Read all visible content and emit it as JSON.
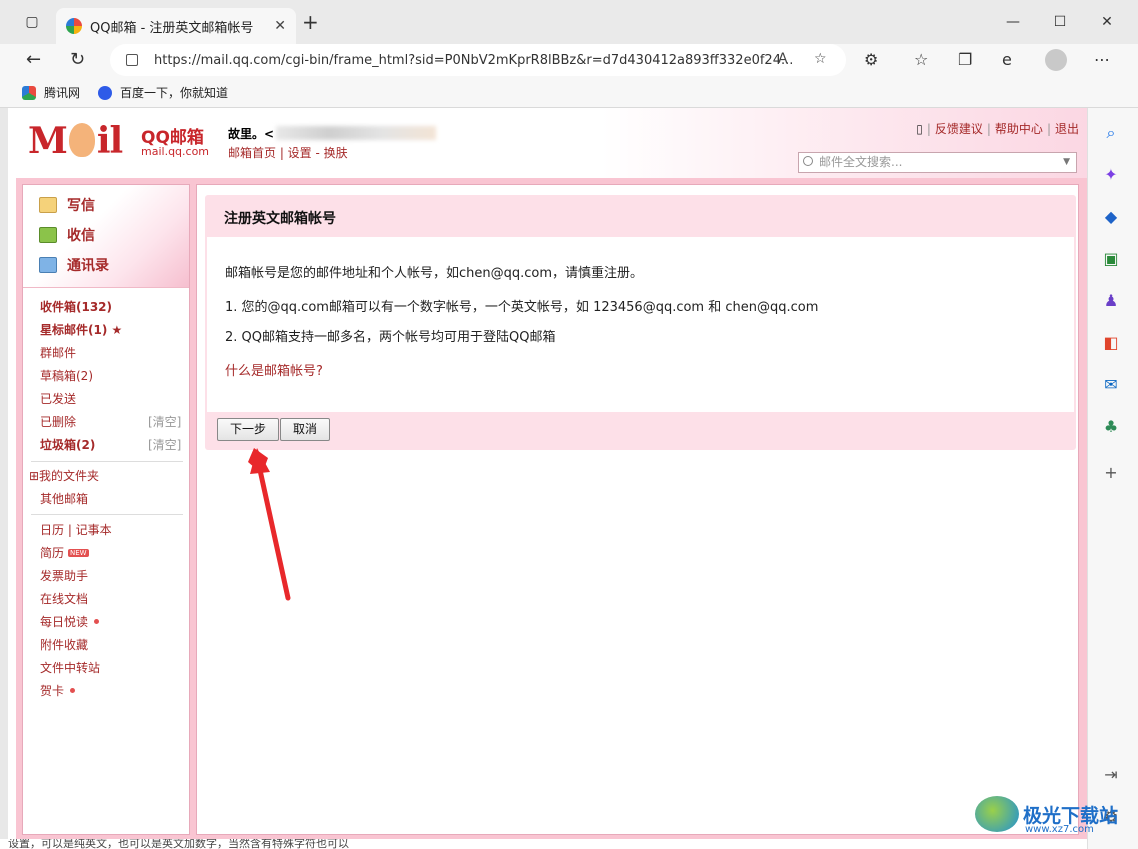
{
  "browser": {
    "tab_title": "QQ邮箱 - 注册英文邮箱帐号",
    "url": "https://mail.qq.com/cgi-bin/frame_html?sid=P0NbV2mKprR8lBBz&r=d7d430412a893ff332e0f24...",
    "bookmarks": [
      "腾讯网",
      "百度一下，你就知道"
    ]
  },
  "header": {
    "logo_text": "M il",
    "brand": "QQ邮箱",
    "domain": "mail.qq.com",
    "user_prefix": "故里。<",
    "user_links": "邮箱首页 | 设置 - 换肤",
    "top_links": [
      "反馈建议",
      "帮助中心",
      "退出"
    ],
    "search_placeholder": "邮件全文搜索..."
  },
  "sidebar": {
    "actions": [
      "写信",
      "收信",
      "通讯录"
    ],
    "folders": [
      {
        "label": "收件箱(132)",
        "bold": true
      },
      {
        "label": "星标邮件(1) ★",
        "bold": true
      },
      {
        "label": "群邮件"
      },
      {
        "label": "草稿箱(2)"
      },
      {
        "label": "已发送"
      },
      {
        "label": "已删除",
        "clear": "[清空]"
      },
      {
        "label": "垃圾箱(2)",
        "bold": true,
        "clear": "[清空]"
      }
    ],
    "my_folders": "⊞我的文件夹",
    "other_mail": "其他邮箱",
    "calendar": "日历  |  记事本",
    "tools": [
      "简历",
      "发票助手",
      "在线文档",
      "每日悦读",
      "附件收藏",
      "文件中转站",
      "贺卡"
    ],
    "new_badge": "NEW"
  },
  "main": {
    "title": "注册英文邮箱帐号",
    "intro": "邮箱帐号是您的邮件地址和个人帐号，如chen@qq.com，请慎重注册。",
    "point1": "1. 您的@qq.com邮箱可以有一个数字帐号，一个英文帐号，如 123456@qq.com 和 chen@qq.com",
    "point2": "2. QQ邮箱支持一邮多名，两个帐号均可用于登陆QQ邮箱",
    "help_link": "什么是邮箱帐号?",
    "next_button": "下一步",
    "cancel_button": "取消"
  },
  "watermark": {
    "name": "极光下载站",
    "url": "www.xz7.com"
  },
  "bottom_text": "设置，可以是纯英文，也可以是英文加数字，当然含有特殊字符也可以",
  "colors": {
    "accent": "#a52a2a",
    "frame": "#f9c5d2",
    "arrow": "#e8282b"
  }
}
